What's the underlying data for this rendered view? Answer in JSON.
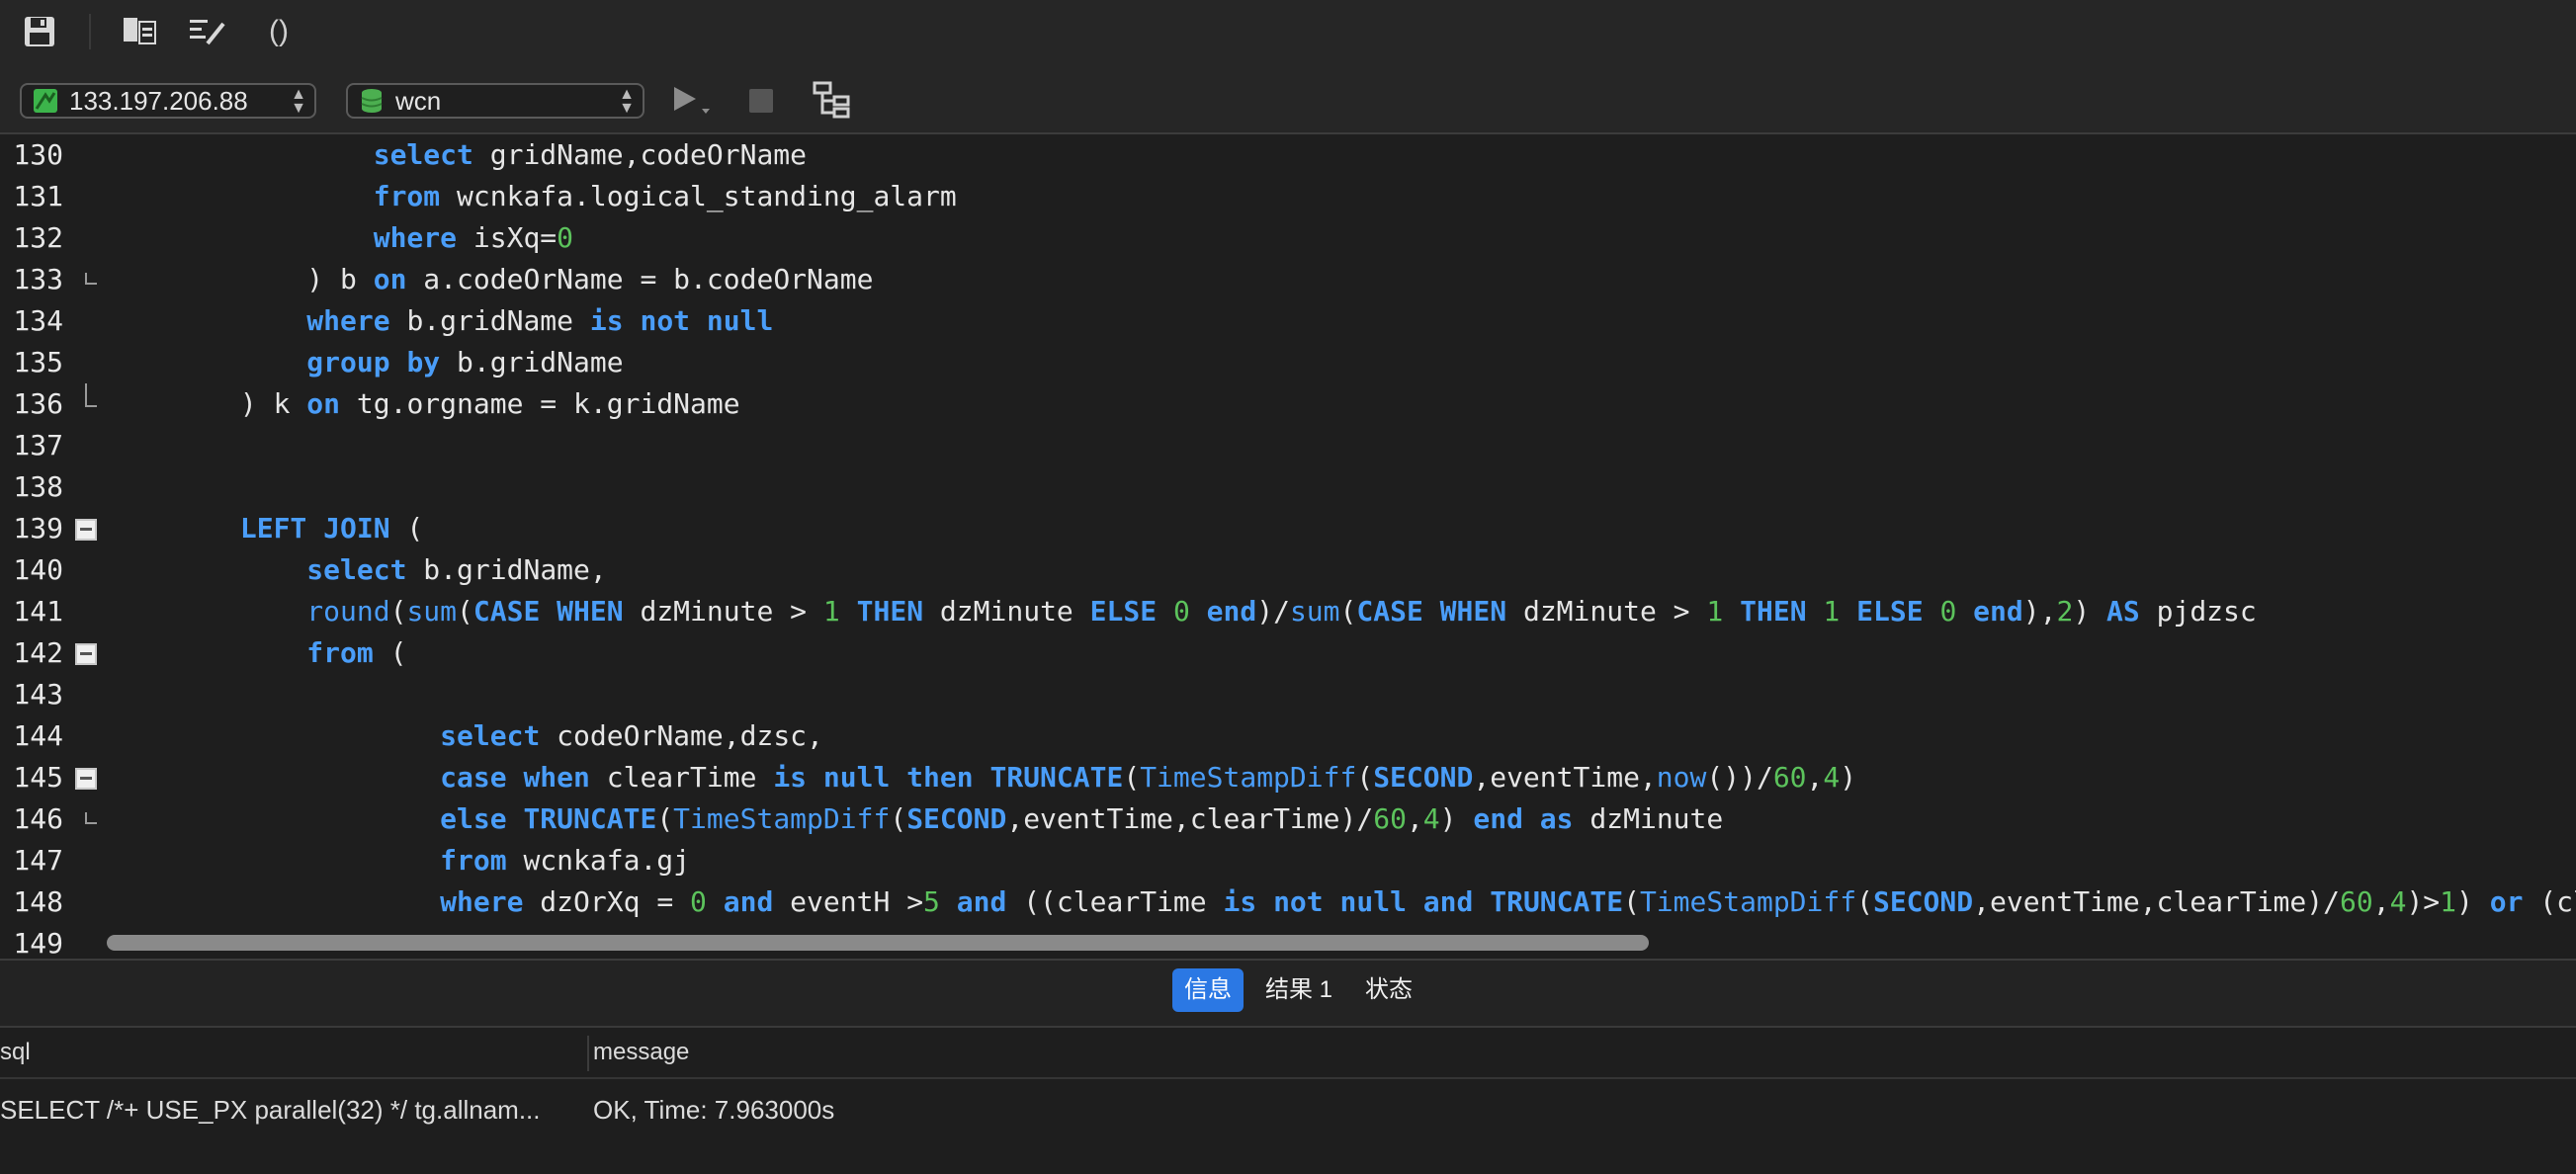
{
  "toolbar": {
    "icons": [
      "save-icon",
      "query-builder-icon",
      "beautify-icon",
      "parentheses-icon"
    ],
    "paren_glyph": "()"
  },
  "connection": {
    "host": "133.197.206.88",
    "database": "wcn",
    "colors": {
      "host_icon": "#3cb44b",
      "db_icon": "#4caf50"
    }
  },
  "editor": {
    "lines": [
      {
        "n": "130",
        "fold": "none",
        "indent": "                ",
        "tokens": [
          [
            "kw",
            "select"
          ],
          [
            "t",
            " gridName,codeOrName"
          ]
        ]
      },
      {
        "n": "131",
        "fold": "none",
        "indent": "                ",
        "tokens": [
          [
            "kw",
            "from"
          ],
          [
            "t",
            " wcnkafa.logical_standing_alarm"
          ]
        ]
      },
      {
        "n": "132",
        "fold": "none",
        "indent": "                ",
        "tokens": [
          [
            "kw",
            "where"
          ],
          [
            "t",
            " isXq="
          ],
          [
            "num",
            "0"
          ]
        ]
      },
      {
        "n": "133",
        "fold": "mid",
        "indent": "            ",
        "tokens": [
          [
            "t",
            ") b "
          ],
          [
            "kw",
            "on"
          ],
          [
            "t",
            " a.codeOrName = b.codeOrName"
          ]
        ]
      },
      {
        "n": "134",
        "fold": "none",
        "indent": "            ",
        "tokens": [
          [
            "kw",
            "where"
          ],
          [
            "t",
            " b.gridName "
          ],
          [
            "kw",
            "is not null"
          ]
        ]
      },
      {
        "n": "135",
        "fold": "none",
        "indent": "            ",
        "tokens": [
          [
            "kw",
            "group by"
          ],
          [
            "t",
            " b.gridName"
          ]
        ]
      },
      {
        "n": "136",
        "fold": "end",
        "indent": "        ",
        "tokens": [
          [
            "t",
            ") k "
          ],
          [
            "kw",
            "on"
          ],
          [
            "t",
            " tg.orgname = k.gridName"
          ]
        ]
      },
      {
        "n": "137",
        "fold": "none",
        "indent": "",
        "tokens": []
      },
      {
        "n": "138",
        "fold": "none",
        "indent": "",
        "tokens": []
      },
      {
        "n": "139",
        "fold": "box",
        "indent": "        ",
        "tokens": [
          [
            "kw",
            "LEFT JOIN"
          ],
          [
            "t",
            " ("
          ]
        ]
      },
      {
        "n": "140",
        "fold": "none",
        "indent": "            ",
        "tokens": [
          [
            "kw",
            "select"
          ],
          [
            "t",
            " b.gridName,"
          ]
        ]
      },
      {
        "n": "141",
        "fold": "none",
        "indent": "            ",
        "tokens": [
          [
            "fn",
            "round"
          ],
          [
            "t",
            "("
          ],
          [
            "fn",
            "sum"
          ],
          [
            "t",
            "("
          ],
          [
            "kw",
            "CASE WHEN"
          ],
          [
            "t",
            " dzMinute > "
          ],
          [
            "num",
            "1"
          ],
          [
            "t",
            " "
          ],
          [
            "kw",
            "THEN"
          ],
          [
            "t",
            " dzMinute "
          ],
          [
            "kw",
            "ELSE"
          ],
          [
            "t",
            " "
          ],
          [
            "num",
            "0"
          ],
          [
            "t",
            " "
          ],
          [
            "kw",
            "end"
          ],
          [
            "t",
            ")/"
          ],
          [
            "fn",
            "sum"
          ],
          [
            "t",
            "("
          ],
          [
            "kw",
            "CASE WHEN"
          ],
          [
            "t",
            " dzMinute > "
          ],
          [
            "num",
            "1"
          ],
          [
            "t",
            " "
          ],
          [
            "kw",
            "THEN"
          ],
          [
            "t",
            " "
          ],
          [
            "num",
            "1"
          ],
          [
            "t",
            " "
          ],
          [
            "kw",
            "ELSE"
          ],
          [
            "t",
            " "
          ],
          [
            "num",
            "0"
          ],
          [
            "t",
            " "
          ],
          [
            "kw",
            "end"
          ],
          [
            "t",
            "),"
          ],
          [
            "num",
            "2"
          ],
          [
            "t",
            ") "
          ],
          [
            "kw",
            "AS"
          ],
          [
            "t",
            " pjdzsc"
          ]
        ]
      },
      {
        "n": "142",
        "fold": "box",
        "indent": "            ",
        "tokens": [
          [
            "kw",
            "from"
          ],
          [
            "t",
            " ("
          ]
        ]
      },
      {
        "n": "143",
        "fold": "none",
        "indent": "",
        "tokens": []
      },
      {
        "n": "144",
        "fold": "none",
        "indent": "                    ",
        "tokens": [
          [
            "kw",
            "select"
          ],
          [
            "t",
            " codeOrName,dzsc,"
          ]
        ]
      },
      {
        "n": "145",
        "fold": "box",
        "indent": "                    ",
        "tokens": [
          [
            "kw",
            "case when"
          ],
          [
            "t",
            " clearTime "
          ],
          [
            "kw",
            "is null then"
          ],
          [
            "t",
            " "
          ],
          [
            "kw",
            "TRUNCATE"
          ],
          [
            "t",
            "("
          ],
          [
            "fn",
            "TimeStampDiff"
          ],
          [
            "t",
            "("
          ],
          [
            "kw",
            "SECOND"
          ],
          [
            "t",
            ",eventTime,"
          ],
          [
            "fn",
            "now"
          ],
          [
            "t",
            "())/"
          ],
          [
            "num",
            "60"
          ],
          [
            "t",
            ","
          ],
          [
            "num",
            "4"
          ],
          [
            "t",
            ")"
          ]
        ]
      },
      {
        "n": "146",
        "fold": "mid",
        "indent": "                    ",
        "tokens": [
          [
            "kw",
            "else"
          ],
          [
            "t",
            " "
          ],
          [
            "kw",
            "TRUNCATE"
          ],
          [
            "t",
            "("
          ],
          [
            "fn",
            "TimeStampDiff"
          ],
          [
            "t",
            "("
          ],
          [
            "kw",
            "SECOND"
          ],
          [
            "t",
            ",eventTime,clearTime)/"
          ],
          [
            "num",
            "60"
          ],
          [
            "t",
            ","
          ],
          [
            "num",
            "4"
          ],
          [
            "t",
            ") "
          ],
          [
            "kw",
            "end as"
          ],
          [
            "t",
            " dzMinute"
          ]
        ]
      },
      {
        "n": "147",
        "fold": "none",
        "indent": "                    ",
        "tokens": [
          [
            "kw",
            "from"
          ],
          [
            "t",
            " wcnkafa.gj"
          ]
        ]
      },
      {
        "n": "148",
        "fold": "none",
        "indent": "                    ",
        "tokens": [
          [
            "kw",
            "where"
          ],
          [
            "t",
            " dzOrXq = "
          ],
          [
            "num",
            "0"
          ],
          [
            "t",
            " "
          ],
          [
            "kw",
            "and"
          ],
          [
            "t",
            " eventH >"
          ],
          [
            "num",
            "5"
          ],
          [
            "t",
            " "
          ],
          [
            "kw",
            "and"
          ],
          [
            "t",
            " ((clearTime "
          ],
          [
            "kw",
            "is not null and"
          ],
          [
            "t",
            " "
          ],
          [
            "kw",
            "TRUNCATE"
          ],
          [
            "t",
            "("
          ],
          [
            "fn",
            "TimeStampDiff"
          ],
          [
            "t",
            "("
          ],
          [
            "kw",
            "SECOND"
          ],
          [
            "t",
            ",eventTime,clearTime)/"
          ],
          [
            "num",
            "60"
          ],
          [
            "t",
            ","
          ],
          [
            "num",
            "4"
          ],
          [
            "t",
            ")>"
          ],
          [
            "num",
            "1"
          ],
          [
            "t",
            ") "
          ],
          [
            "kw",
            "or"
          ],
          [
            "t",
            " (cl"
          ]
        ]
      },
      {
        "n": "149",
        "fold": "none",
        "indent": "",
        "tokens": []
      }
    ]
  },
  "tabs": [
    {
      "label": "信息",
      "active": true
    },
    {
      "label": "结果 1",
      "active": false
    },
    {
      "label": "状态",
      "active": false
    }
  ],
  "result": {
    "columns": [
      "sql",
      "message"
    ],
    "rows": [
      [
        "SELECT /*+ USE_PX parallel(32) */ tg.allnam...",
        "OK, Time: 7.963000s"
      ]
    ]
  }
}
